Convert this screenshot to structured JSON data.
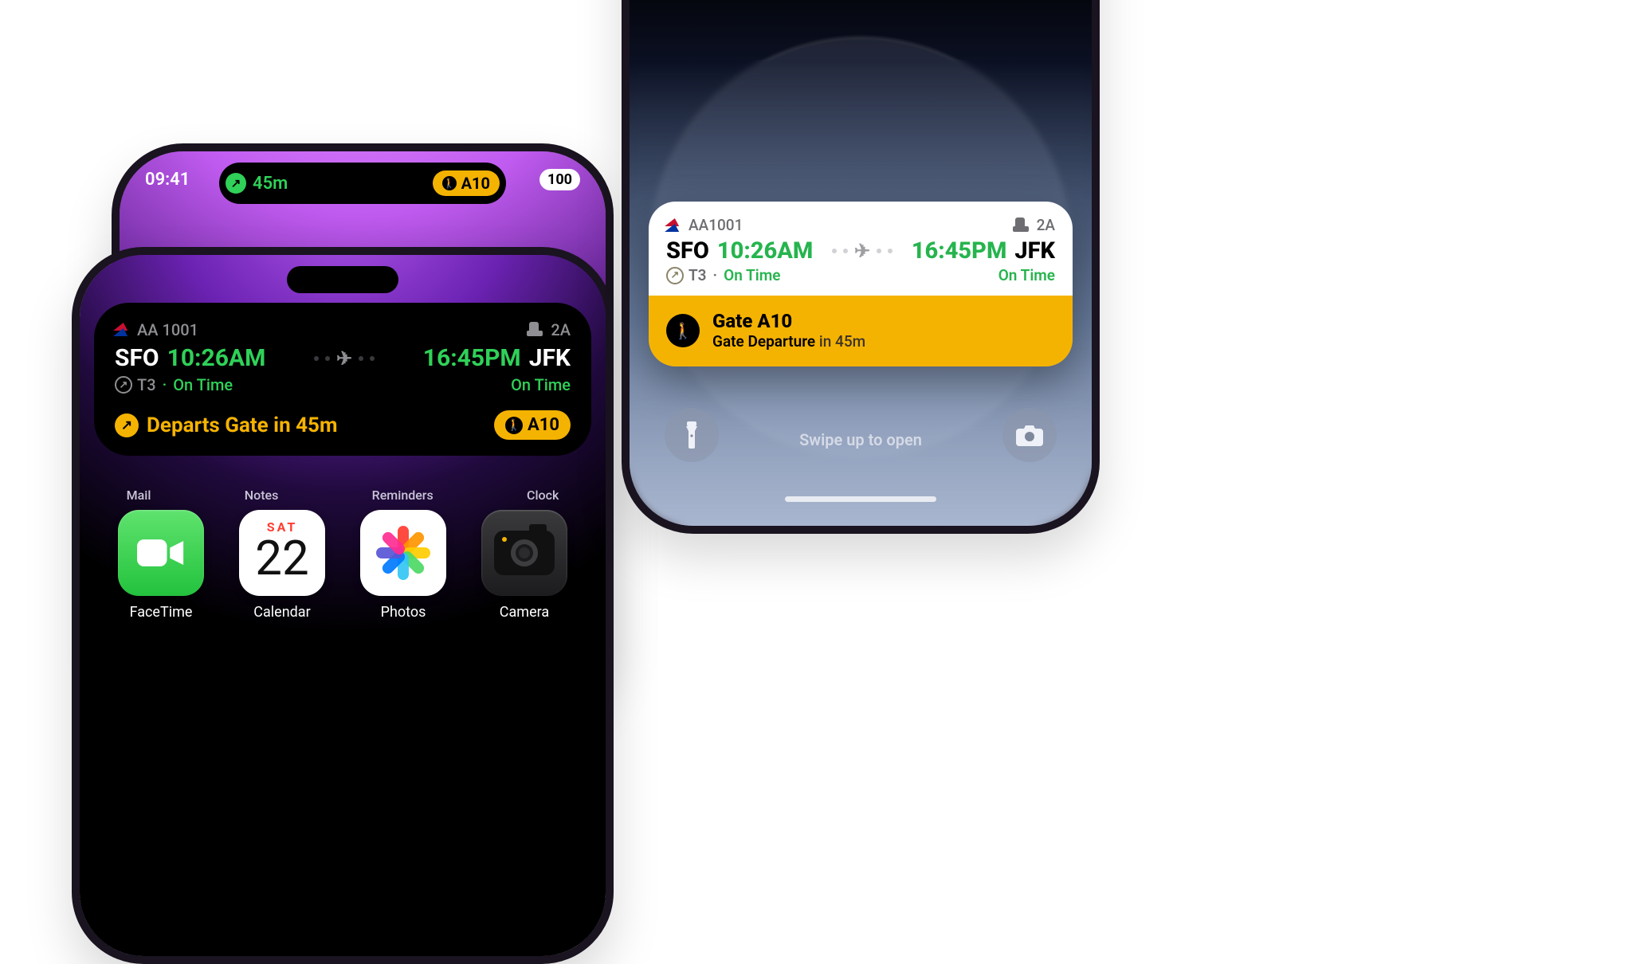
{
  "status": {
    "time": "09:41",
    "battery": "100"
  },
  "island_compact": {
    "countdown": "45m",
    "gate_code": "A10"
  },
  "flight": {
    "number_spaced": "AA 1001",
    "number_tight": "AA1001",
    "seat": "2A",
    "origin_code": "SFO",
    "origin_time": "10:26AM",
    "dest_time": "16:45PM",
    "dest_code": "JFK",
    "origin_terminal": "T3",
    "origin_status": "On Time",
    "dest_status": "On Time",
    "dot": "·"
  },
  "island_expanded": {
    "departs_label": "Departs Gate in 45m",
    "gate_code": "A10"
  },
  "lockscreen": {
    "gate_title": "Gate A10",
    "gate_sub_prefix": "Gate Departure",
    "gate_sub_suffix": " in 45m",
    "swipe_hint": "Swipe up to open"
  },
  "home": {
    "peek": [
      "Mail",
      "Notes",
      "Reminders",
      "Clock"
    ],
    "apps": {
      "facetime": "FaceTime",
      "calendar": "Calendar",
      "photos": "Photos",
      "camera": "Camera"
    },
    "calendar_tile": {
      "weekday": "SAT",
      "day": "22"
    }
  },
  "petal_colors": [
    "#ff3b30",
    "#ff9500",
    "#ffcc00",
    "#4cd964",
    "#34c7f4",
    "#007aff",
    "#5856d6",
    "#ff2d92"
  ]
}
